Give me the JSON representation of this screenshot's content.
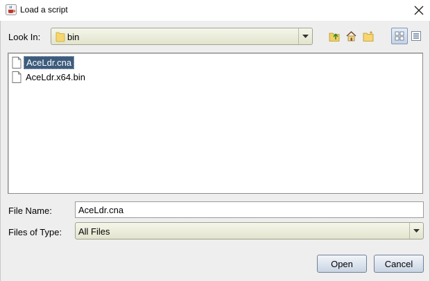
{
  "window": {
    "title": "Load a script",
    "app_icon": "java-coffee-cup-icon",
    "close_icon": "close-icon"
  },
  "look_in": {
    "label": "Look In:",
    "value": "bin",
    "value_icon": "folder-icon"
  },
  "toolbar": {
    "icons": [
      "up-one-level-icon",
      "home-icon",
      "new-folder-icon",
      "list-view-icon",
      "details-view-icon"
    ],
    "active_view": "list-view"
  },
  "files": [
    {
      "name": "AceLdr.cna",
      "selected": true,
      "icon": "document-icon"
    },
    {
      "name": "AceLdr.x64.bin",
      "selected": false,
      "icon": "document-icon"
    }
  ],
  "file_name": {
    "label": "File Name:",
    "value": "AceLdr.cna"
  },
  "files_of_type": {
    "label": "Files of Type:",
    "value": "All Files"
  },
  "buttons": {
    "open": "Open",
    "cancel": "Cancel"
  },
  "colors": {
    "selection": "#3d5c7d",
    "combo_bg": "#e9ebd8",
    "button_bg": "#d6dee9",
    "dialog_bg": "#eeeeee"
  }
}
